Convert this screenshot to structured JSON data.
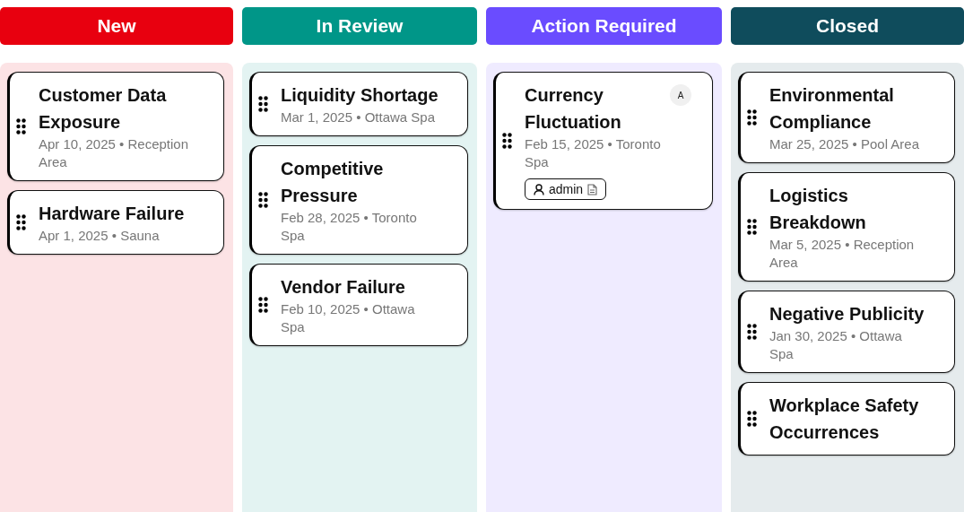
{
  "columns": [
    {
      "title": "New",
      "color": "#e8000f",
      "cards": [
        {
          "title": "Customer Data Exposure",
          "meta": "Apr 10, 2025 • Reception Area"
        },
        {
          "title": "Hardware Failure",
          "meta": "Apr 1, 2025 • Sauna"
        }
      ]
    },
    {
      "title": "In Review",
      "color": "#009688",
      "cards": [
        {
          "title": "Liquidity Shortage",
          "meta": "Mar 1, 2025 • Ottawa Spa"
        },
        {
          "title": "Competitive Pressure",
          "meta": "Feb 28, 2025 • Toronto Spa"
        },
        {
          "title": "Vendor Failure",
          "meta": "Feb 10, 2025 • Ottawa Spa"
        }
      ]
    },
    {
      "title": "Action Required",
      "color": "#6a4cff",
      "cards": [
        {
          "title": "Currency Fluctuation",
          "meta": "Feb 15, 2025 • Toronto Spa",
          "avatar": "A",
          "assignee": "admin"
        }
      ]
    },
    {
      "title": "Closed",
      "color": "#0f4c5c",
      "cards": [
        {
          "title": "Environmental Compliance",
          "meta": "Mar 25, 2025 • Pool Area"
        },
        {
          "title": "Logistics Breakdown",
          "meta": "Mar 5, 2025 • Reception Area"
        },
        {
          "title": "Negative Publicity",
          "meta": "Jan 30, 2025 • Ottawa Spa"
        },
        {
          "title": "Workplace Safety Occurrences"
        }
      ]
    }
  ]
}
